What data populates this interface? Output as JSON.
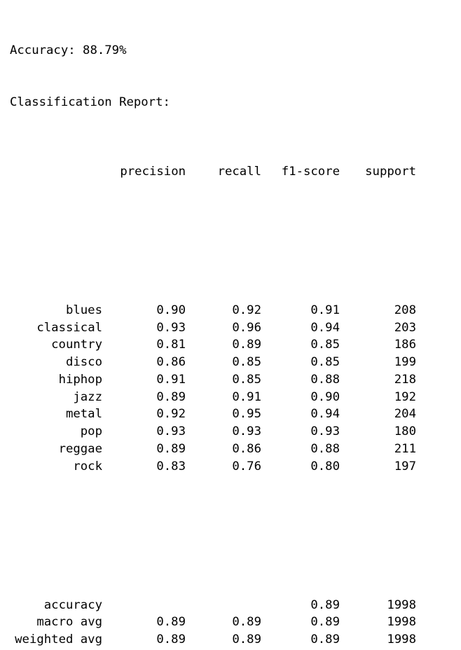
{
  "accuracy_line": "Accuracy: 88.79%",
  "report_title": "Classification Report:",
  "headers": [
    "precision",
    "recall",
    "f1-score",
    "support"
  ],
  "rows": [
    {
      "label": "blues",
      "precision": "0.90",
      "recall": "0.92",
      "f1": "0.91",
      "support": "208"
    },
    {
      "label": "classical",
      "precision": "0.93",
      "recall": "0.96",
      "f1": "0.94",
      "support": "203"
    },
    {
      "label": "country",
      "precision": "0.81",
      "recall": "0.89",
      "f1": "0.85",
      "support": "186"
    },
    {
      "label": "disco",
      "precision": "0.86",
      "recall": "0.85",
      "f1": "0.85",
      "support": "199"
    },
    {
      "label": "hiphop",
      "precision": "0.91",
      "recall": "0.85",
      "f1": "0.88",
      "support": "218"
    },
    {
      "label": "jazz",
      "precision": "0.89",
      "recall": "0.91",
      "f1": "0.90",
      "support": "192"
    },
    {
      "label": "metal",
      "precision": "0.92",
      "recall": "0.95",
      "f1": "0.94",
      "support": "204"
    },
    {
      "label": "pop",
      "precision": "0.93",
      "recall": "0.93",
      "f1": "0.93",
      "support": "180"
    },
    {
      "label": "reggae",
      "precision": "0.89",
      "recall": "0.86",
      "f1": "0.88",
      "support": "211"
    },
    {
      "label": "rock",
      "precision": "0.83",
      "recall": "0.76",
      "f1": "0.80",
      "support": "197"
    }
  ],
  "summary": [
    {
      "label": "accuracy",
      "precision": "",
      "recall": "",
      "f1": "0.89",
      "support": "1998"
    },
    {
      "label": "macro avg",
      "precision": "0.89",
      "recall": "0.89",
      "f1": "0.89",
      "support": "1998"
    },
    {
      "label": "weighted avg",
      "precision": "0.89",
      "recall": "0.89",
      "f1": "0.89",
      "support": "1998"
    }
  ]
}
